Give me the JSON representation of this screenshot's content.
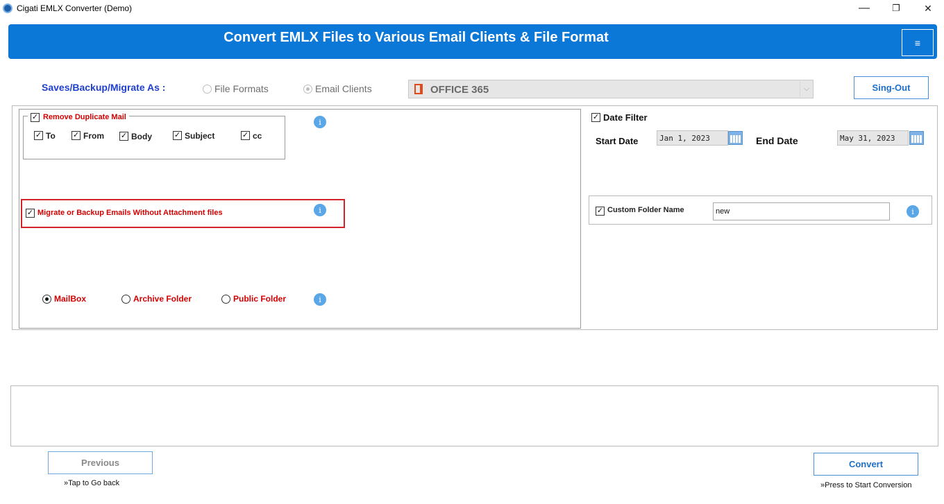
{
  "window": {
    "title": "Cigati EMLX Converter (Demo)",
    "minimize": "—",
    "restore": "❐",
    "close": "✕"
  },
  "banner": {
    "title": "Convert EMLX Files to Various Email Clients & File Format",
    "menu_icon": "≡"
  },
  "save_as": {
    "label": "Saves/Backup/Migrate As :",
    "options": [
      {
        "label": "File Formats",
        "selected": false
      },
      {
        "label": "Email Clients",
        "selected": true
      }
    ],
    "client_select": {
      "value": "OFFICE 365",
      "icon": "office365-icon"
    },
    "signout_label": "Sing-Out"
  },
  "duplicate": {
    "label": "Remove Duplicate Mail",
    "checked": true,
    "fields": [
      {
        "label": "To",
        "checked": true
      },
      {
        "label": "From",
        "checked": true
      },
      {
        "label": "Body",
        "checked": true
      },
      {
        "label": "Subject",
        "checked": true
      },
      {
        "label": "cc",
        "checked": true
      }
    ]
  },
  "no_attachment": {
    "label": "Migrate or Backup Emails Without Attachment files",
    "checked": true
  },
  "folder_type": {
    "options": [
      {
        "label": "MailBox",
        "selected": true
      },
      {
        "label": "Archive Folder",
        "selected": false
      },
      {
        "label": "Public Folder",
        "selected": false
      }
    ]
  },
  "date_filter": {
    "label": "Date Filter",
    "checked": true,
    "start_label": "Start Date",
    "start_value": "Jan 1, 2023",
    "end_label": "End Date",
    "end_value": "May 31, 2023"
  },
  "custom_folder": {
    "label": "Custom Folder Name",
    "checked": true,
    "value": "new"
  },
  "info_glyph": "i",
  "check_glyph": "✓",
  "footer": {
    "previous_label": "Previous",
    "previous_hint": "»Tap to Go back",
    "convert_label": "Convert",
    "convert_hint": "»Press to Start Conversion"
  },
  "colors": {
    "banner": "#0b77d6",
    "accent_red": "#d40000",
    "label_blue": "#1f3fcf",
    "highlight_border": "#d2232a"
  }
}
